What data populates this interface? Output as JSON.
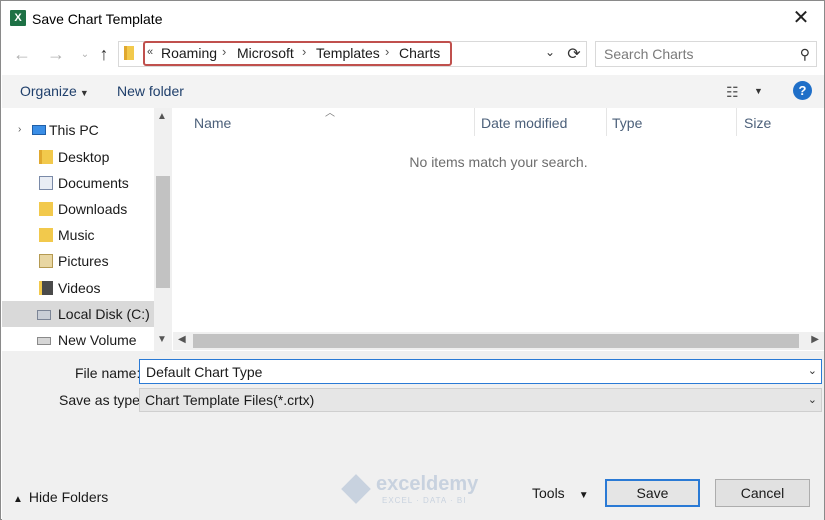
{
  "window": {
    "title": "Save Chart Template",
    "app_icon_letter": "X",
    "close_glyph": "✕"
  },
  "address": {
    "overflow": "«",
    "crumbs": [
      "Roaming",
      "Microsoft",
      "Templates",
      "Charts"
    ],
    "separator": "›"
  },
  "search": {
    "placeholder": "Search Charts"
  },
  "toolbar": {
    "organize_label": "Organize",
    "new_folder_label": "New folder",
    "help_label": "?"
  },
  "nav_pane": {
    "items": [
      {
        "label": "This PC",
        "icon": "pc-icon"
      },
      {
        "label": "Desktop",
        "icon": "folder-icon"
      },
      {
        "label": "Documents",
        "icon": "documents-icon"
      },
      {
        "label": "Downloads",
        "icon": "downloads-icon"
      },
      {
        "label": "Music",
        "icon": "music-icon"
      },
      {
        "label": "Pictures",
        "icon": "pictures-icon"
      },
      {
        "label": "Videos",
        "icon": "videos-icon"
      },
      {
        "label": "Local Disk (C:)",
        "icon": "disk-icon",
        "selected": true
      },
      {
        "label": "New Volume (E:)",
        "icon": "volume-icon"
      }
    ]
  },
  "file_list": {
    "columns": [
      "Name",
      "Date modified",
      "Type",
      "Size"
    ],
    "empty_message": "No items match your search."
  },
  "form": {
    "filename_label": "File name:",
    "filename_value": "Default Chart Type",
    "savetype_label": "Save as type:",
    "savetype_value": "Chart Template Files(*.crtx)"
  },
  "footer": {
    "hide_folders_label": "Hide Folders",
    "tools_label": "Tools",
    "save_label": "Save",
    "cancel_label": "Cancel"
  },
  "watermark": {
    "text": "exceldemy",
    "subtext": "EXCEL · DATA · BI"
  },
  "colors": {
    "accent": "#2a7ad5",
    "highlight_box": "#c0504d",
    "excel_green": "#1e7145"
  }
}
